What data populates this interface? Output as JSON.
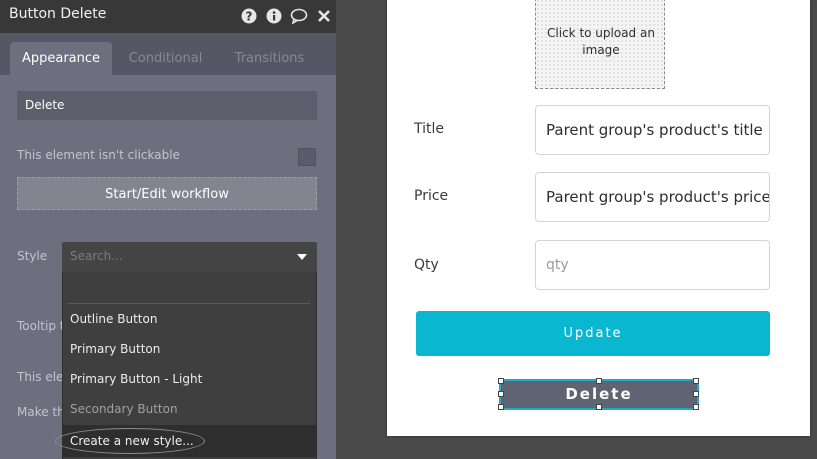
{
  "panel": {
    "title": "Button Delete",
    "icons": [
      "help-icon",
      "info-icon",
      "comment-icon",
      "close-icon"
    ],
    "tabs": [
      {
        "label": "Appearance",
        "active": true
      },
      {
        "label": "Conditional",
        "active": false
      },
      {
        "label": "Transitions",
        "active": false
      }
    ],
    "element_name": "Delete",
    "not_clickable_label": "This element isn't clickable",
    "workflow_button": "Start/Edit workflow",
    "style_label": "Style",
    "style_search_placeholder": "Search...",
    "hidden_labels": {
      "tooltip": "Tooltip t",
      "this_element": "This ele",
      "make_this": "Make th"
    },
    "style_options": [
      {
        "label": "Outline Button"
      },
      {
        "label": "Primary Button"
      },
      {
        "label": "Primary Button - Light"
      },
      {
        "label": "Secondary Button"
      }
    ],
    "create_style": "Create a new style..."
  },
  "canvas": {
    "uploader_text": "Click to upload an image",
    "fields": [
      {
        "label": "Title",
        "value": "Parent group's product's title"
      },
      {
        "label": "Price",
        "value": "Parent group's product's price"
      },
      {
        "label": "Qty",
        "placeholder": "qty"
      }
    ],
    "update_button": "Update",
    "delete_button": "Delete"
  },
  "colors": {
    "panel_bg": "#6d6f7f",
    "header_bg": "#383838",
    "accent_cyan": "#0ab7d0",
    "delete_button_bg": "#606371",
    "dropdown_bg": "#3f3f3f"
  }
}
